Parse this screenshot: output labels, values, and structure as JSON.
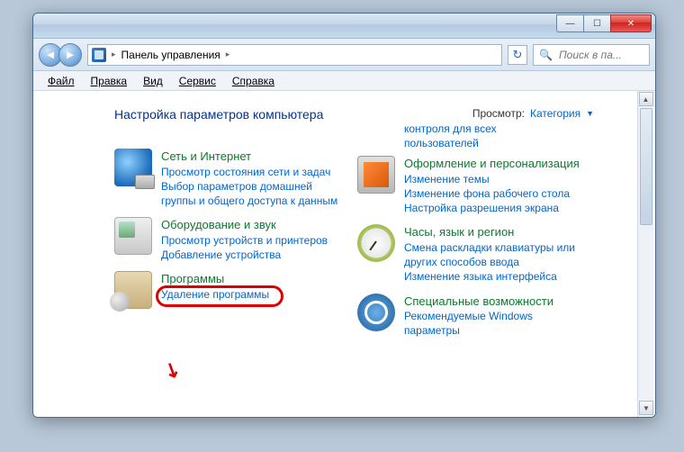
{
  "titlebar": {
    "min": "—",
    "max": "☐",
    "close": "✕"
  },
  "nav": {
    "back": "◄",
    "forward": "►",
    "breadcrumb": "Панель управления",
    "sep": "▸",
    "refresh": "↻",
    "search_placeholder": "Поиск в па..."
  },
  "menu": {
    "file": "Файл",
    "edit": "Правка",
    "view": "Вид",
    "tools": "Сервис",
    "help": "Справка"
  },
  "content": {
    "heading": "Настройка параметров компьютера",
    "view_label": "Просмотр:",
    "view_value": "Категория",
    "tri": "▼"
  },
  "left": {
    "net": {
      "title": "Сеть и Интернет",
      "l1": "Просмотр состояния сети и задач",
      "l2": "Выбор параметров домашней группы и общего доступа к данным"
    },
    "hw": {
      "title": "Оборудование и звук",
      "l1": "Просмотр устройств и принтеров",
      "l2": "Добавление устройства"
    },
    "prog": {
      "title": "Программы",
      "l1": "Удаление программы"
    }
  },
  "right": {
    "partial1": "контроля для всех",
    "partial2": "пользователей",
    "appear": {
      "title": "Оформление и персонализация",
      "l1": "Изменение темы",
      "l2": "Изменение фона рабочего стола",
      "l3": "Настройка разрешения экрана"
    },
    "clock": {
      "title": "Часы, язык и регион",
      "l1": "Смена раскладки клавиатуры или других способов ввода",
      "l2": "Изменение языка интерфейса"
    },
    "access": {
      "title": "Специальные возможности",
      "l1": "Рекомендуемые Windows",
      "l2_cut": "параметры"
    }
  }
}
